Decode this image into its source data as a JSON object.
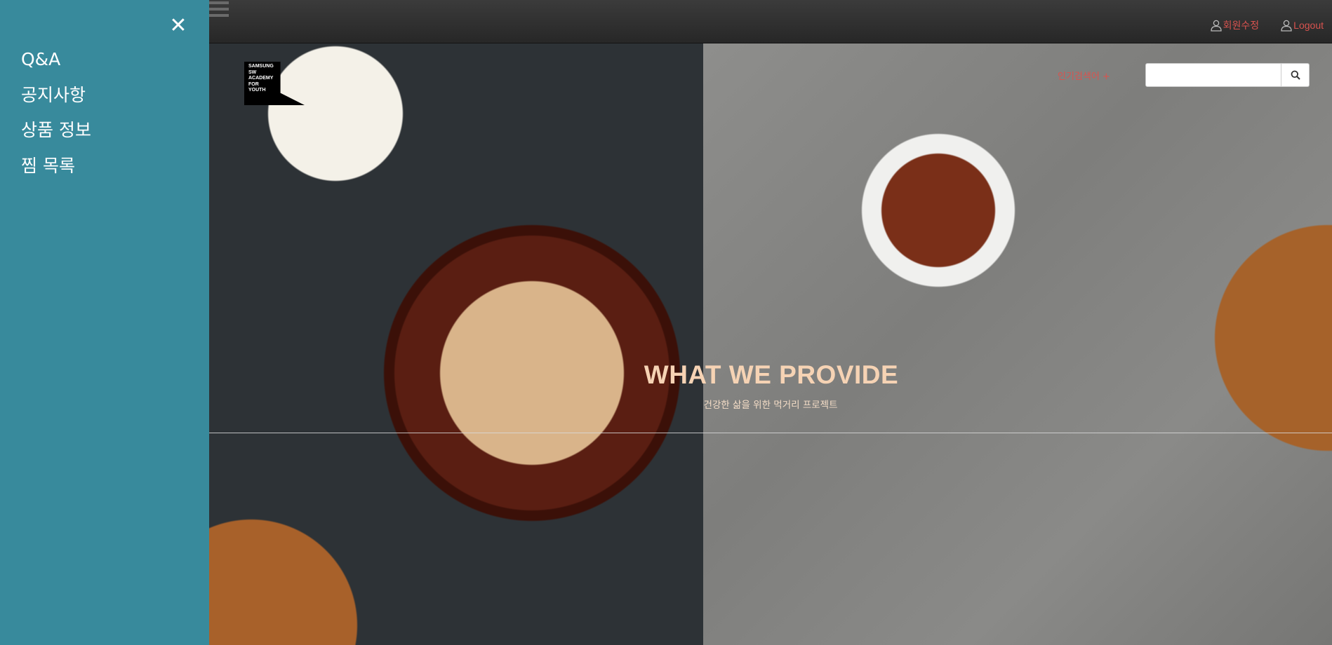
{
  "sidebar": {
    "close_symbol": "✕",
    "items": [
      {
        "label": "Q&A"
      },
      {
        "label": "공지사항"
      },
      {
        "label": "상품 정보"
      },
      {
        "label": "찜 목록"
      }
    ]
  },
  "header": {
    "menu_icon": "hamburger-icon",
    "links": [
      {
        "label": "회원수정",
        "icon": "user-icon"
      },
      {
        "label": "Logout",
        "icon": "user-icon"
      }
    ]
  },
  "brand": {
    "logo_lines": [
      "SAMSUNG",
      "SW",
      "ACADEMY",
      "FOR",
      "YOUTH"
    ]
  },
  "search": {
    "recommend_label": "인기검색어 +",
    "value": "",
    "placeholder": "",
    "button_icon": "search-icon"
  },
  "hero": {
    "title": "WHAT WE PROVIDE",
    "subtitle": "건강한 삶을 위한 먹거리 프로젝트"
  },
  "colors": {
    "sidebar_bg": "#388a9c",
    "accent_red": "#d9534f",
    "headline": "#f6d3b4",
    "topbar": "#2f2f2f"
  }
}
